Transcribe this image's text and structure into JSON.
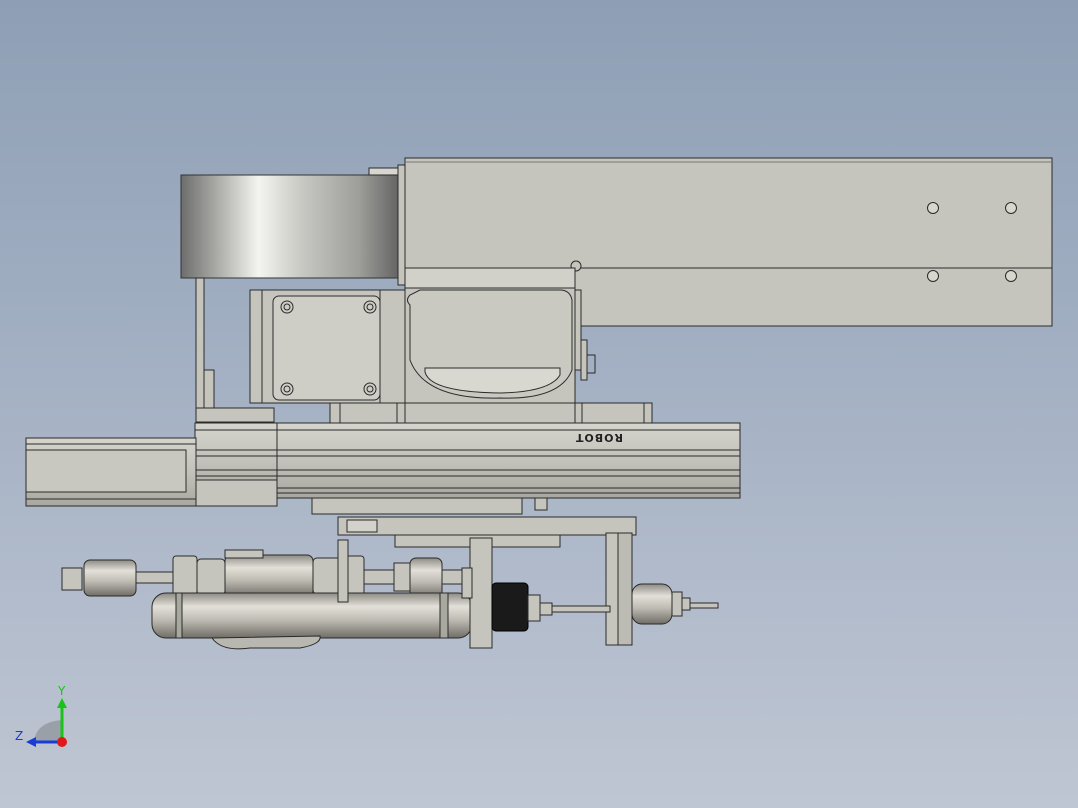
{
  "viewport": {
    "background_top": "#8e9fb5",
    "background_bottom": "#bfc6d3"
  },
  "model": {
    "part_fill": "#c6c5bd",
    "part_stroke": "#2a2a2a",
    "logo_text": "ROBOT"
  },
  "triad": {
    "y_label": "Y",
    "z_label": "Z",
    "y_color": "#18c418",
    "z_color": "#1a3cd8",
    "x_color": "#e01818"
  }
}
